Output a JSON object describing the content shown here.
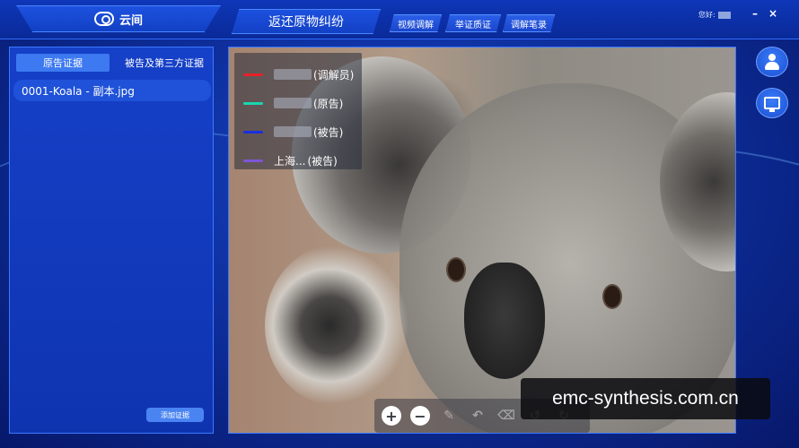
{
  "header": {
    "app_name": "云间",
    "case_title": "返还原物纠纷",
    "tabs": [
      "视频调解",
      "举证质证",
      "调解笔录"
    ],
    "greeting": "您好:",
    "minimize": "–",
    "close": "×"
  },
  "left_panel": {
    "tabs": [
      "原告证据",
      "被告及第三方证据"
    ],
    "active_tab": "原告证据",
    "files": [
      "0001-Koala - 副本.jpg"
    ],
    "add_button": "添加证据"
  },
  "viewer": {
    "participants": [
      {
        "name_prefix": "",
        "role": "(调解员)",
        "color": "#e8202a"
      },
      {
        "name_prefix": "",
        "role": "(原告)",
        "color": "#19d6b0"
      },
      {
        "name_prefix": "",
        "role": "(被告)",
        "color": "#1a2fe0"
      },
      {
        "name_prefix": "上海...",
        "role": "(被告)",
        "color": "#7f55d8"
      }
    ],
    "toolbar": {
      "zoom_in": "+",
      "zoom_out": "−",
      "pen": "✎",
      "undo": "↶",
      "eraser": "⌫",
      "rotate_left": "↺",
      "rotate_right": "↻"
    }
  },
  "side": {
    "icons": [
      "user-icon",
      "screen-share-icon"
    ]
  },
  "watermark": "emc-synthesis.com.cn"
}
